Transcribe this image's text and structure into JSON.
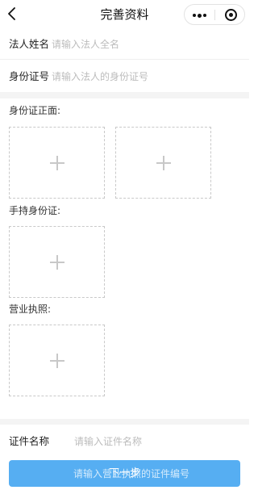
{
  "nav": {
    "back_icon": "chevron-left-icon",
    "title": "完善资料",
    "menu_icon": "more-dots-icon",
    "close_icon": "target-circle-icon"
  },
  "form": {
    "legal_name": {
      "label": "法人姓名",
      "placeholder": "请输入法人全名"
    },
    "id_number": {
      "label": "身份证号",
      "placeholder": "请输入法人的身份证号"
    }
  },
  "uploads": {
    "id_front": {
      "label": "身份证正面:"
    },
    "id_in_hand": {
      "label": "手持身份证:"
    },
    "business_license": {
      "label": "营业执照:"
    }
  },
  "certificate": {
    "name": {
      "label": "证件名称",
      "placeholder": "请输入证件名称"
    },
    "number_placeholder": "请输入营业执照的证件编号"
  },
  "next_button": {
    "label": "下一步"
  },
  "colors": {
    "primary": "#56aef2",
    "placeholder": "#bcbcbc",
    "section_gap": "#f4f4f4"
  }
}
